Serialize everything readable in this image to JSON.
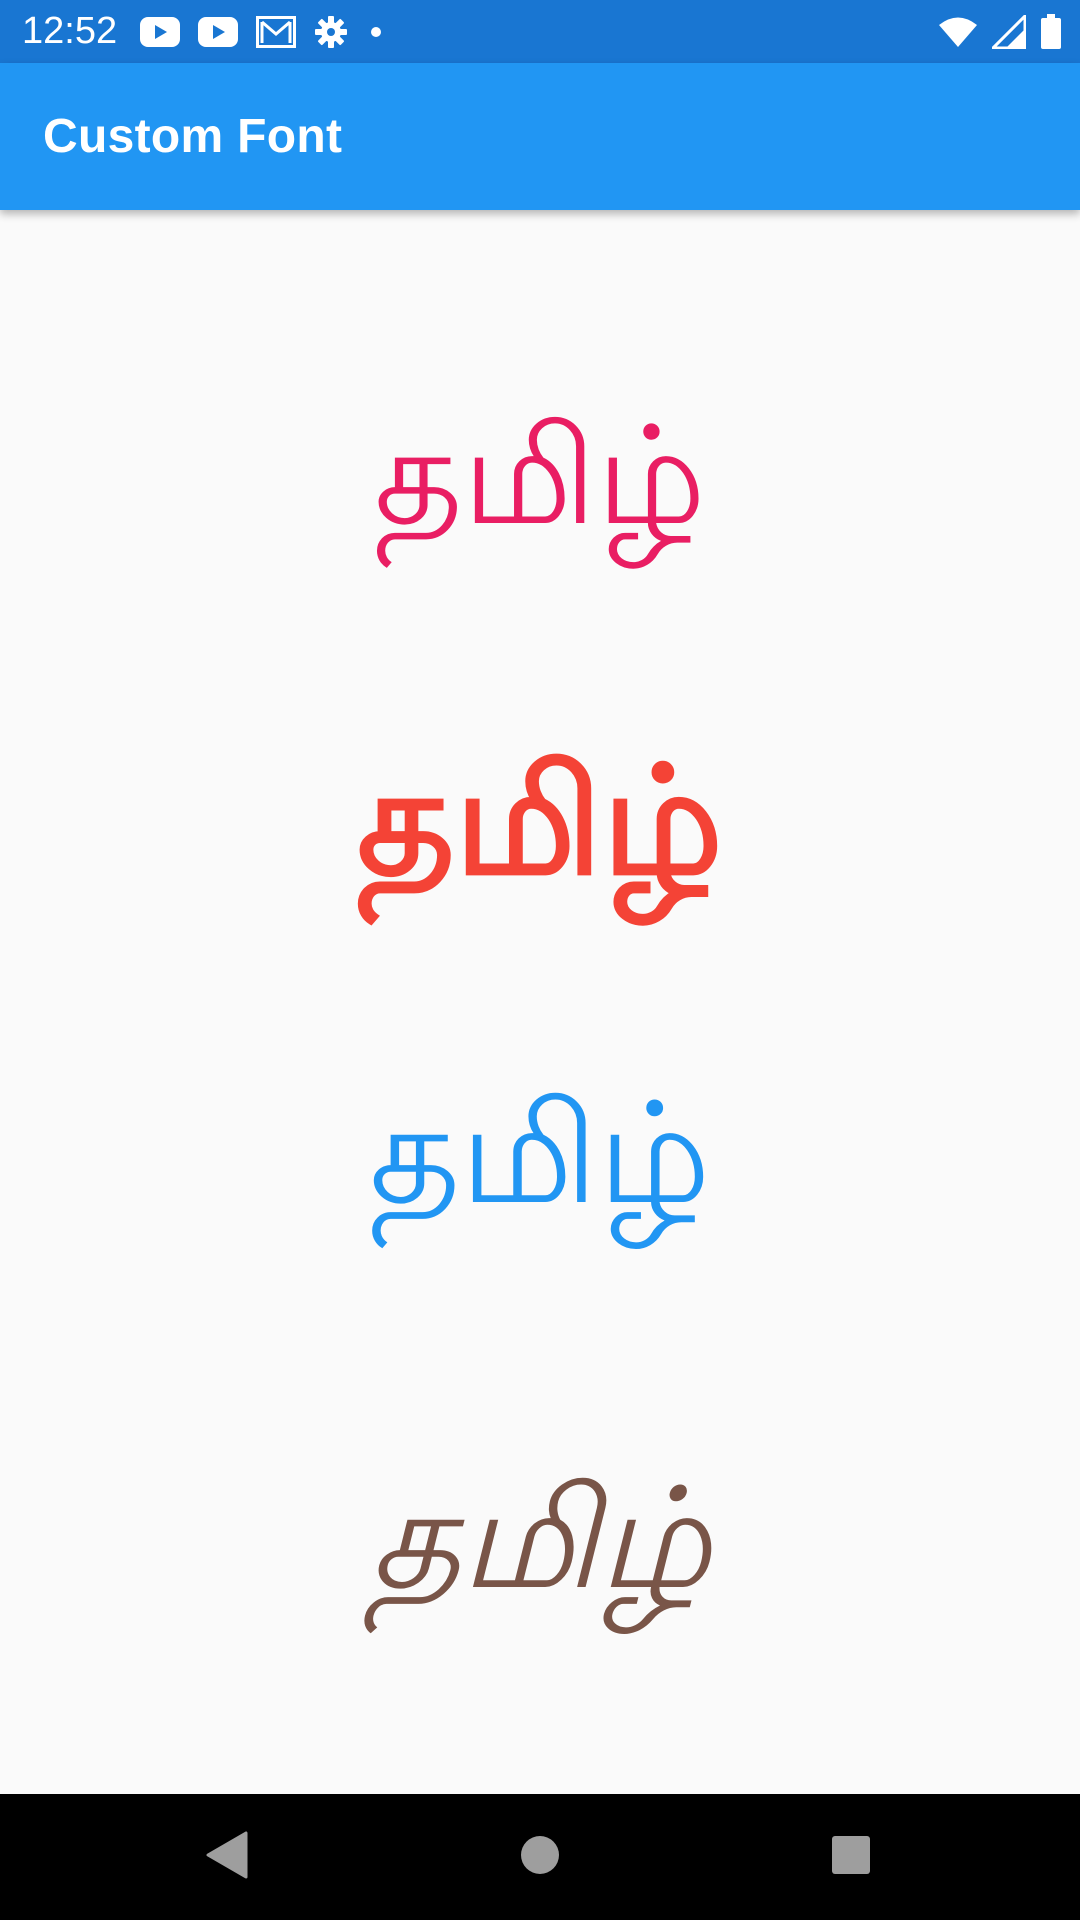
{
  "status_bar": {
    "time": "12:52",
    "left_icons": [
      "youtube-icon",
      "youtube-icon",
      "gmail-icon",
      "settings-icon",
      "dot-icon"
    ],
    "right_icons": [
      "wifi-icon",
      "signal-icon",
      "battery-icon"
    ],
    "background": "#1976d2"
  },
  "app_bar": {
    "title": "Custom Font",
    "background": "#2196f3"
  },
  "main": {
    "texts": [
      {
        "text": "தமிழ்",
        "color": "#e91e63",
        "style": "regular"
      },
      {
        "text": "தமிழ்",
        "color": "#f44336",
        "style": "bold"
      },
      {
        "text": "தமிழ்",
        "color": "#2196f3",
        "style": "light"
      },
      {
        "text": "தமிழ்",
        "color": "#795548",
        "style": "italic"
      }
    ]
  },
  "nav_bar": {
    "buttons": [
      "back-icon",
      "home-icon",
      "recents-icon"
    ]
  }
}
